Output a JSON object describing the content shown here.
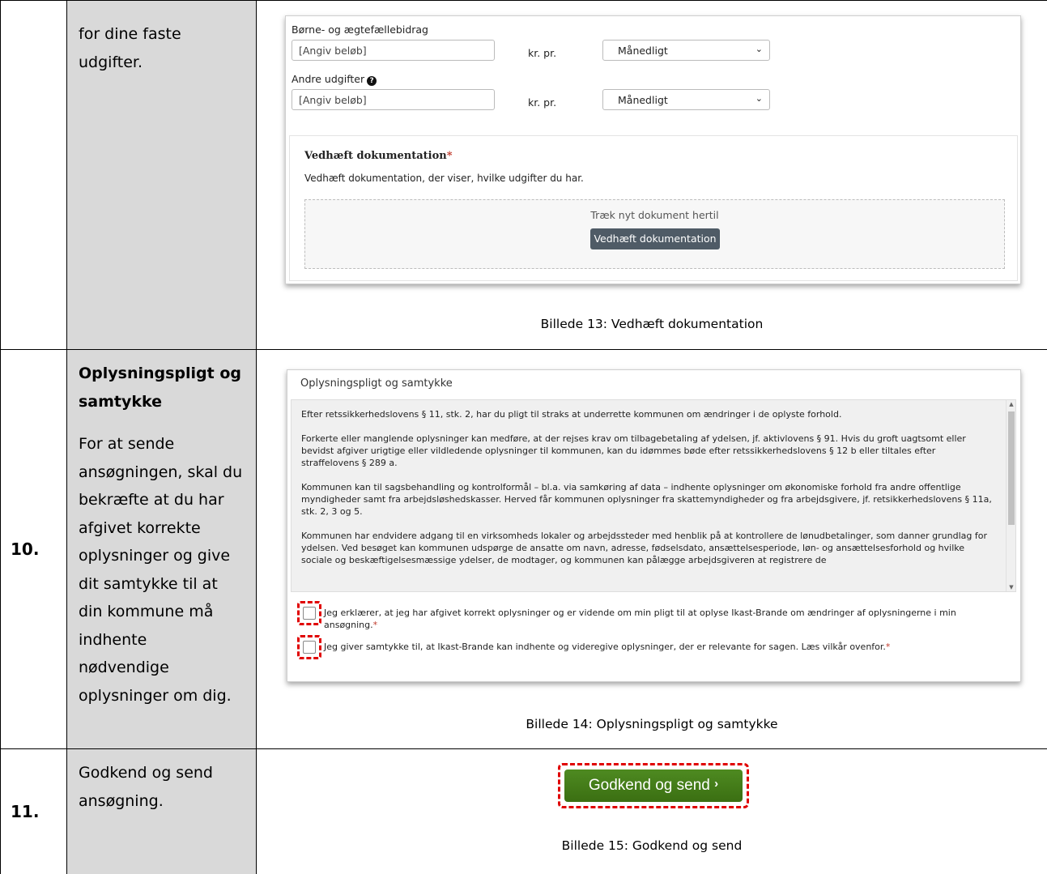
{
  "row1": {
    "desc_lines": [
      "for dine faste",
      "udgifter."
    ],
    "screenshot": {
      "field1_label": "Børne- og ægtefællebidrag",
      "field1_placeholder": "[Angiv beløb]",
      "field1_unit": "kr. pr.",
      "field1_select": "Månedligt",
      "field2_label": "Andre udgifter",
      "field2_placeholder": "[Angiv beløb]",
      "field2_unit": "kr. pr.",
      "field2_select": "Månedligt",
      "attach_title": "Vedhæft dokumentation",
      "attach_required": "*",
      "attach_desc": "Vedhæft dokumentation, der viser, hvilke udgifter du har.",
      "dropzone_text": "Træk nyt dokument hertil",
      "attach_button": "Vedhæft dokumentation"
    },
    "caption": "Billede 13: Vedhæft dokumentation"
  },
  "row2": {
    "number": "10.",
    "title_lines": [
      "Oplysningspligt og",
      "samtykke"
    ],
    "desc_lines": [
      "For at sende",
      "ansøgningen, skal du",
      "bekræfte at du har",
      "afgivet korrekte",
      "oplysninger og give",
      "dit samtykke til at",
      "din kommune må",
      "indhente",
      "nødvendige",
      "oplysninger om dig."
    ],
    "screenshot": {
      "heading": "Oplysningspligt og samtykke",
      "paragraphs": [
        "Efter retssikkerhedslovens § 11, stk. 2, har du pligt til straks at underrette kommunen om ændringer i de oplyste forhold.",
        "Forkerte eller manglende oplysninger kan medføre, at der rejses krav om tilbagebetaling af ydelsen, jf. aktivlovens § 91. Hvis du groft uagtsomt eller bevidst afgiver urigtige eller vildledende oplysninger til kommunen, kan du idømmes bøde efter retssikkerhedslovens § 12 b eller tiltales efter straffelovens § 289 a.",
        "Kommunen kan til sagsbehandling og kontrolformål – bl.a. via samkøring af data – indhente oplysninger om økonomiske forhold fra andre offentlige myndigheder samt fra arbejdsløshedskasser. Herved får kommunen oplysninger fra skattemyndigheder og fra arbejdsgivere, jf. retsikkerhedslovens § 11a, stk. 2, 3 og 5.",
        "Kommunen har endvidere adgang til en virksomheds lokaler og arbejdssteder med henblik på at kontrollere de lønudbetalinger, som danner grundlag for ydelsen. Ved besøget kan kommunen udspørge de ansatte om navn, adresse, fødselsdato, ansættelsesperiode, løn- og ansættelsesforhold og hvilke sociale og beskæftigelsesmæssige ydelser, de modtager, og kommunen kan pålægge arbejdsgiveren at registrere de"
      ],
      "checkbox1_label": "Jeg erklærer, at jeg har afgivet korrekt oplysninger og er vidende om min pligt til at oplyse Ikast-Brande om ændringer af oplysningerne i min ansøgning.",
      "checkbox2_label": "Jeg giver samtykke til, at Ikast-Brande kan indhente og videregive oplysninger, der er relevante for sagen. Læs vilkår ovenfor.",
      "required_mark": "*"
    },
    "caption": "Billede 14: Oplysningspligt og samtykke"
  },
  "row3": {
    "number": "11.",
    "desc_lines": [
      "Godkend og send",
      "ansøgning."
    ],
    "button_label": "Godkend og send",
    "caption": "Billede 15: Godkend og send"
  },
  "colors": {
    "desc_bg": "#d9d9d9",
    "highlight": "#e00000",
    "green_button": "#4a7f1c",
    "attach_button": "#4f5b66"
  },
  "icons": [
    "question-circle-icon",
    "chevron-down-icon",
    "chevron-right-icon"
  ]
}
